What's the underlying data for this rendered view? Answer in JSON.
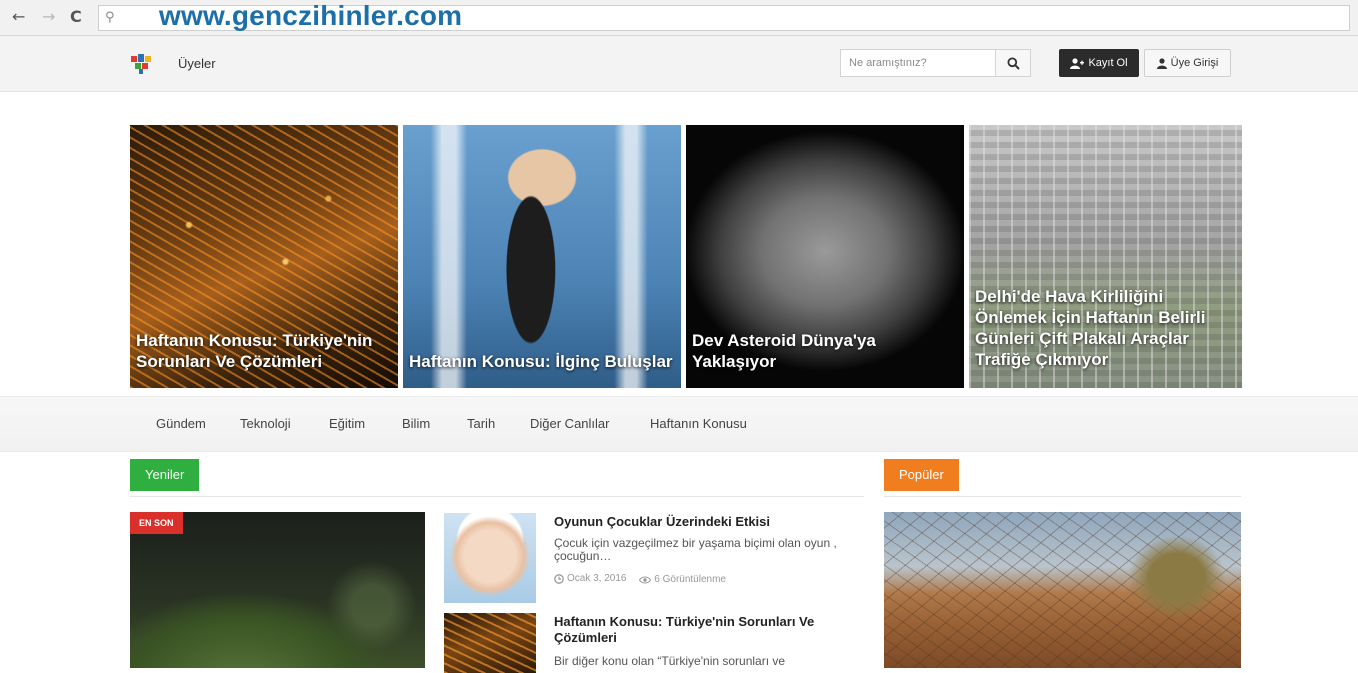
{
  "browser": {
    "url": "www.genczihinler.com",
    "back_icon": "arrow-left-icon",
    "forward_icon": "arrow-right-icon",
    "reload_icon": "reload-icon",
    "search_icon": "magnifier-icon",
    "back_glyph": "←",
    "forward_glyph": "→",
    "reload_glyph": "C",
    "search_glyph": "⚲"
  },
  "header": {
    "members_label": "Üyeler",
    "search_placeholder": "Ne aramıştınız?",
    "register_label": "Kayıt Ol",
    "login_label": "Üye Girişi",
    "colors": {
      "register_bg": "#2b2b2b",
      "logo_red": "#e23b2e",
      "logo_blue": "#2a72b5",
      "logo_yellow": "#f3b21b",
      "logo_green": "#3aa63a"
    }
  },
  "hero": [
    {
      "caption": "Haftanın Konusu: Türkiye'nin Sorunları Ve Çözümleri"
    },
    {
      "caption": "Haftanın Konusu: İlginç Buluşlar"
    },
    {
      "caption": "Dev Asteroid Dünya'ya Yaklaşıyor"
    },
    {
      "caption": "Delhi'de Hava Kirliliğini Önlemek İçin Haftanın Belirli Günleri Çift Plakalı Araçlar Trafiğe Çıkmıyor"
    }
  ],
  "categories": [
    "Gündem",
    "Teknoloji",
    "Eğitim",
    "Bilim",
    "Tarih",
    "Diğer Canlılar",
    "Haftanın Konusu"
  ],
  "sections": {
    "new_label": "Yeniler",
    "popular_label": "Popüler",
    "colors": {
      "new": "#2eaf40",
      "popular": "#f07e1f",
      "badge": "#d9302b"
    }
  },
  "featured": {
    "badge": "EN SON"
  },
  "articles": [
    {
      "title": "Oyunun Çocuklar Üzerindeki Etkisi",
      "excerpt": "Çocuk için vazgeçilmez bir yaşama biçimi olan oyun , çocuğun…",
      "date": "Ocak 3, 2016",
      "views": "6 Görüntülenme"
    },
    {
      "title": "Haftanın Konusu: Türkiye'nin Sorunları Ve Çözümleri",
      "excerpt": "Bir diğer konu olan “Türkiye'nin sorunları ve"
    }
  ]
}
